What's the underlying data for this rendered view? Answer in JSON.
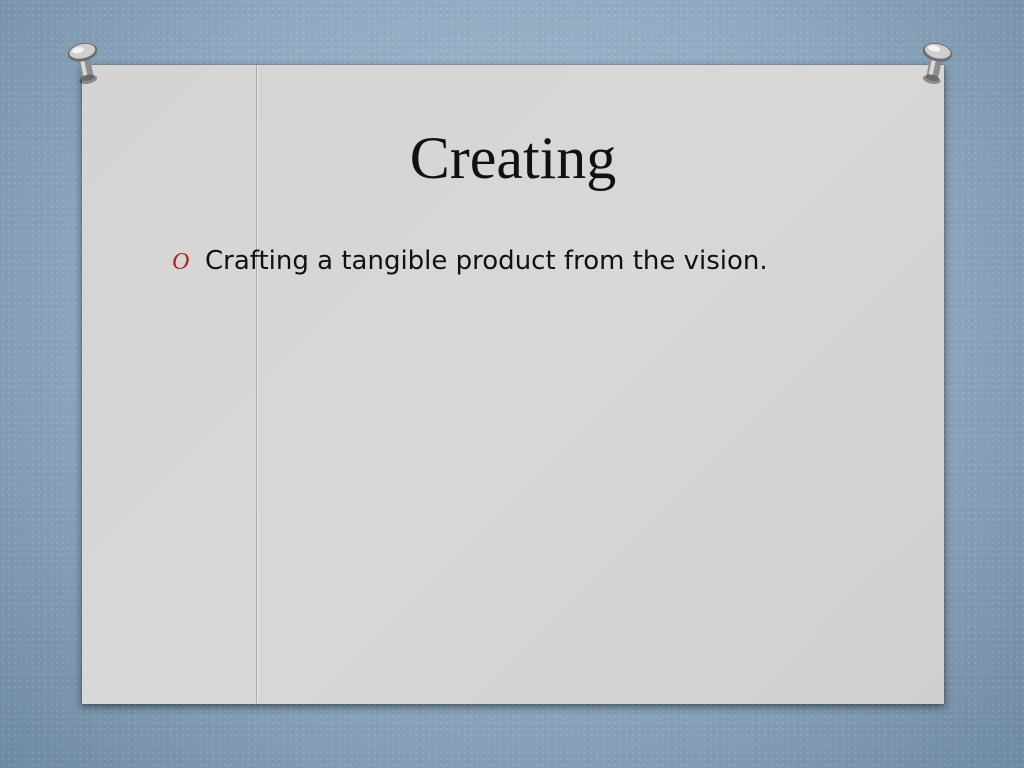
{
  "slide": {
    "title": "Creating",
    "bullets": [
      {
        "glyph": "O",
        "text": "Crafting a tangible product from the vision."
      }
    ]
  },
  "colors": {
    "backdrop": "#8fa9c0",
    "card": "#d6d6d6",
    "bullet": "#b22222",
    "text": "#111111"
  },
  "icons": {
    "left_pin": "pushpin-icon",
    "right_pin": "pushpin-icon"
  }
}
